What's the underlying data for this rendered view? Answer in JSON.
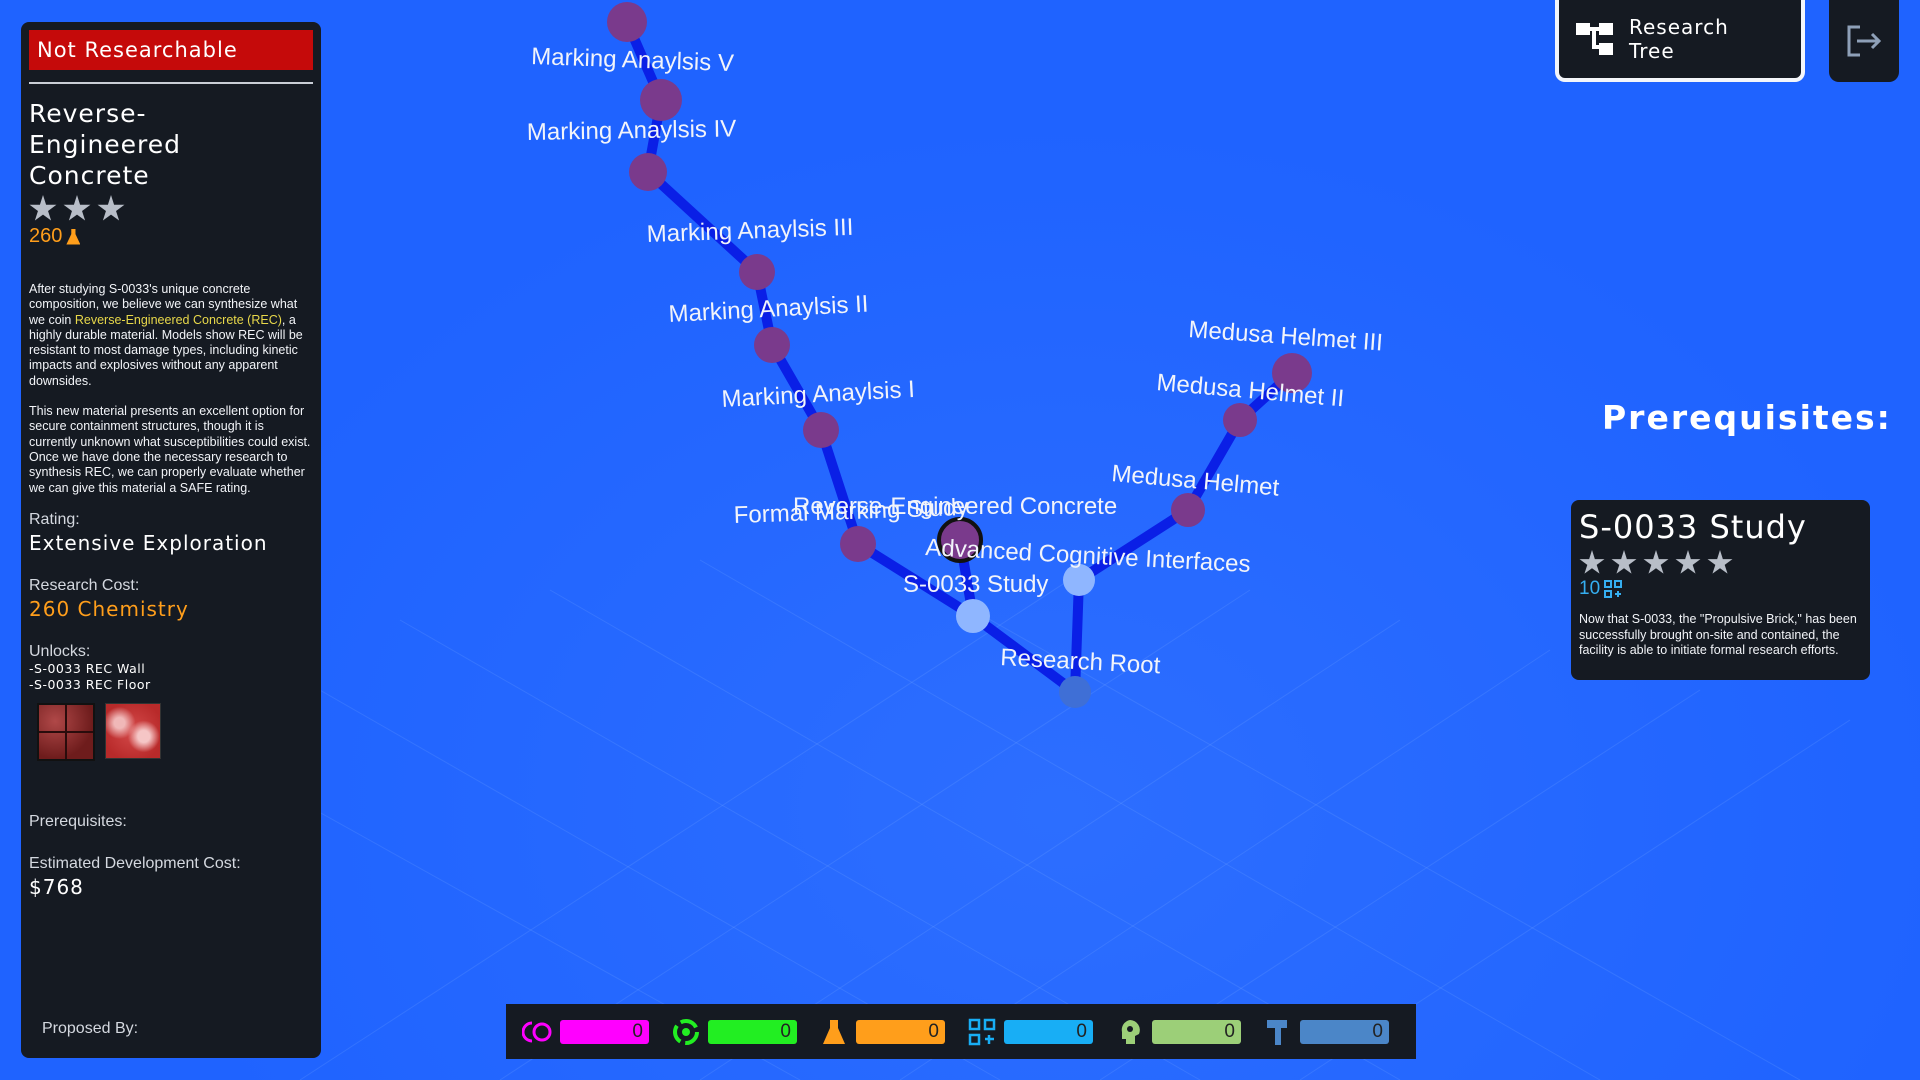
{
  "left_panel": {
    "status_badge": "Not Researchable",
    "title": "Reverse-Engineered Concrete",
    "stars": 3,
    "cost_value": "260",
    "description_p1_before": "After studying S-0033's unique concrete composition, we believe we can synthesize what we coin ",
    "description_p1_highlight": "Reverse-Engineered Concrete (REC)",
    "description_p1_after": ", a highly durable material. Models show REC will be resistant to most damage types, including kinetic impacts and explosives without any apparent downsides.",
    "description_p2": "This new material presents an excellent option for secure containment structures, though it is currently unknown what susceptibilities could exist. Once we have done the necessary research to synthesis REC, we can properly evaluate whether we can give this material a SAFE rating.",
    "rating_label": "Rating:",
    "rating_value": "Extensive Exploration",
    "research_cost_label": "Research Cost:",
    "research_cost_value": "260 Chemistry",
    "unlocks_label": "Unlocks:",
    "unlocks": [
      "-S-0033 REC Wall",
      "-S-0033 REC  Floor"
    ],
    "prerequisites_label": "Prerequisites:",
    "dev_cost_label": "Estimated Development Cost:",
    "dev_cost_value": "$768",
    "proposed_by_label": "Proposed By:"
  },
  "top_right": {
    "research_tree_label_1": "Research",
    "research_tree_label_2": "Tree"
  },
  "prerequisites_panel": {
    "heading": "Prerequisites:",
    "card_title": "S-0033 Study",
    "card_stars": 5,
    "card_cost": "10",
    "card_description": "Now that S-0033, the \"Propulsive Brick,\" has been successfully brought on-site and contained, the facility is able to initiate formal research efforts."
  },
  "tree": {
    "nodes": {
      "ma5": "Marking Anaylsis V",
      "ma4": "Marking Anaylsis IV",
      "ma3": "Marking Anaylsis III",
      "ma2": "Marking Anaylsis II",
      "ma1": "Marking Anaylsis I",
      "fms": "Formal Marking Study",
      "rec": "Reverse-Engineered Concrete",
      "aci": "Advanced Cognitive Interfaces",
      "s33": "S-0033 Study",
      "root": "Research Root",
      "mh1": "Medusa Helmet",
      "mh2": "Medusa Helmet II",
      "mh3": "Medusa Helmet III"
    },
    "colors": {
      "locked_node": "#7a3a8c",
      "unlocked_node": "#8fb6ff",
      "root_node": "#3f6fd6",
      "edge": "#0a1fe6"
    }
  },
  "resources": [
    {
      "name": "containment",
      "icon": "cycle-icon",
      "value": "0",
      "color": "#ff00ff"
    },
    {
      "name": "biology",
      "icon": "biohazard-icon",
      "value": "0",
      "color": "#22ee22"
    },
    {
      "name": "chemistry",
      "icon": "flask-icon",
      "value": "0",
      "color": "#ff9e1b"
    },
    {
      "name": "technology",
      "icon": "circuit-icon",
      "value": "0",
      "color": "#18aef5"
    },
    {
      "name": "psychology",
      "icon": "head-icon",
      "value": "0",
      "color": "#9ccf78"
    },
    {
      "name": "engineering",
      "icon": "hammer-icon",
      "value": "0",
      "color": "#4b86c8"
    }
  ]
}
